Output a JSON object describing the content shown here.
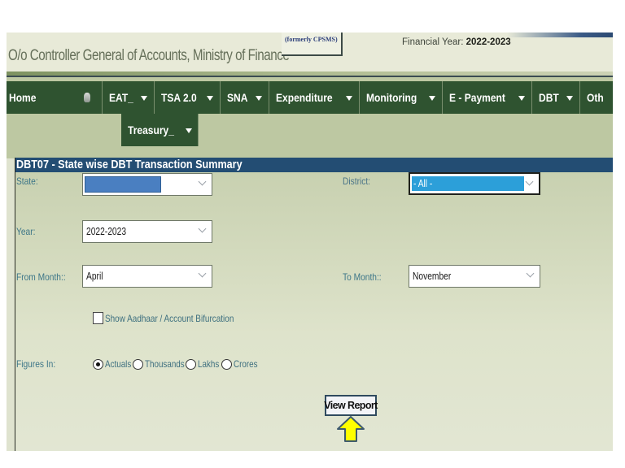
{
  "header": {
    "org_title": "O/o Controller General of Accounts, Ministry of Finance",
    "formerly": "(formerly CPSMS)",
    "financial_year_label": "Financial Year: ",
    "financial_year_value": "2022-2023"
  },
  "nav": {
    "items": [
      {
        "label": "Home",
        "icon": "home-icon"
      },
      {
        "label": "EAT_",
        "dropdown": true
      },
      {
        "label": "TSA 2.0",
        "dropdown": true
      },
      {
        "label": "SNA",
        "dropdown": true
      },
      {
        "label": "Expenditure",
        "dropdown": true
      },
      {
        "label": "Monitoring",
        "dropdown": true
      },
      {
        "label": "E - Payment",
        "dropdown": true
      },
      {
        "label": "DBT",
        "dropdown": true
      },
      {
        "label": "Oth"
      }
    ],
    "second_row": [
      {
        "label": "Treasury_",
        "dropdown": true
      }
    ]
  },
  "report": {
    "title": "DBT07 - State wise DBT Transaction Summary",
    "fields": {
      "state": {
        "label": "State:",
        "value": ""
      },
      "district": {
        "label": "District:",
        "value": "- All -"
      },
      "year": {
        "label": "Year:",
        "value": "2022-2023"
      },
      "from_month": {
        "label": "From Month::",
        "value": "April"
      },
      "to_month": {
        "label": "To Month::",
        "value": "November"
      }
    },
    "show_aadhaar": {
      "label": "Show Aadhaar / Account Bifurcation",
      "checked": false
    },
    "figures_in": {
      "label": "Figures In:",
      "options": [
        "Actuals",
        "Thousands",
        "Lakhs",
        "Crores"
      ],
      "selected": "Actuals"
    },
    "view_report_label": "View Report"
  },
  "colors": {
    "nav_bg": "#2f5330",
    "title_bar": "#234d73",
    "state_highlight": "#4a7fc1",
    "district_highlight": "#2c9fd9",
    "label_text": "#3d7688",
    "arrow_fill": "#ffff00"
  }
}
